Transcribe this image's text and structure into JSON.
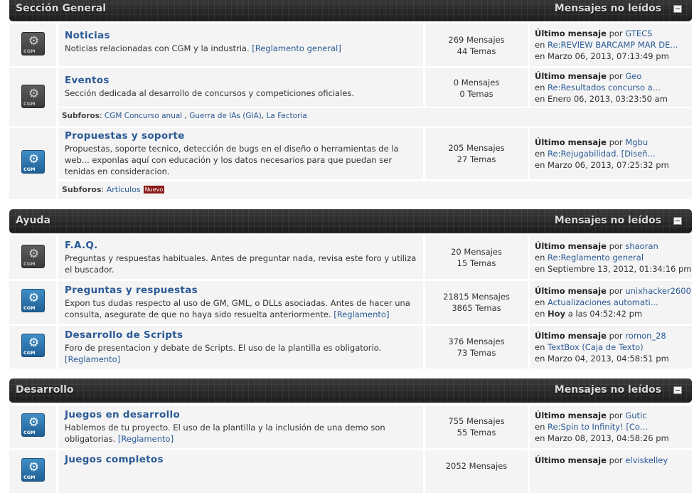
{
  "categories": [
    {
      "title": "Sección General",
      "unread": "Mensajes no leídos"
    },
    {
      "title": "Ayuda",
      "unread": "Mensajes no leídos"
    },
    {
      "title": "Desarrollo",
      "unread": "Mensajes no leídos"
    }
  ],
  "icon_text": "CGM",
  "boards": [
    {
      "name": "Noticias",
      "desc": "Noticias relacionadas con CGM y la industria.",
      "desc_link": "[Reglamento general]",
      "posts": "269 Mensajes",
      "topics": "44 Temas",
      "lp_label": "Último mensaje",
      "lp_by": "por",
      "lp_user": "GTECS",
      "lp_in": "en",
      "lp_topic": "Re:REVIEW BARCAMP MAR DE...",
      "lp_date": "en Marzo 06, 2013, 07:13:49 pm"
    },
    {
      "name": "Eventos",
      "desc": "Sección dedicada al desarrollo de concursos y competiciones oficiales.",
      "desc_link": "",
      "posts": "0 Mensajes",
      "topics": "0 Temas",
      "lp_label": "Último mensaje",
      "lp_by": "por",
      "lp_user": "Geo",
      "lp_in": "en",
      "lp_topic": "Re:Resultados concurso a...",
      "lp_date": "en Enero 06, 2013, 03:23:50 am"
    },
    {
      "name": "Propuestas y soporte",
      "desc": "Propuestas, soporte tecnico, detección de bugs en el diseño o herramientas de la web... exponlas aquí con educación y los datos necesarios para que puedan ser tenidas en consideracion.",
      "desc_link": "",
      "posts": "205 Mensajes",
      "topics": "27 Temas",
      "lp_label": "Último mensaje",
      "lp_by": "por",
      "lp_user": "Mgbu",
      "lp_in": "en",
      "lp_topic": "Re:Rejugabilidad. [Diseñ...",
      "lp_date": "en Marzo 06, 2013, 07:25:32 pm"
    },
    {
      "name": "F.A.Q.",
      "desc": "Preguntas y respuestas habituales. Antes de preguntar nada, revisa este foro y utiliza el buscador.",
      "desc_link": "",
      "posts": "20 Mensajes",
      "topics": "15 Temas",
      "lp_label": "Último mensaje",
      "lp_by": "por",
      "lp_user": "shaoran",
      "lp_in": "en",
      "lp_topic": "Re:Reglamento general",
      "lp_date": "en Septiembre 13, 2012, 01:34:16 pm"
    },
    {
      "name": "Preguntas y respuestas",
      "desc": "Expon tus dudas respecto al uso de GM, GML, o DLLs asociadas. Antes de hacer una consulta, asegurate de que no haya sido resuelta anteriormente.",
      "desc_link": "[Reglamento]",
      "posts": "21815 Mensajes",
      "topics": "3865 Temas",
      "lp_label": "Último mensaje",
      "lp_by": "por",
      "lp_user": "unixhacker2600",
      "lp_in": "en",
      "lp_topic": "Actualizaciones automati...",
      "lp_date_prefix": "en",
      "lp_date_bold": "Hoy",
      "lp_date": "a las 04:52:42 pm"
    },
    {
      "name": "Desarrollo de Scripts",
      "desc": "Foro de presentacion y debate de Scripts. El uso de la plantilla es obligatorio.",
      "desc_link": "[Reglamento]",
      "posts": "376 Mensajes",
      "topics": "73 Temas",
      "lp_label": "Último mensaje",
      "lp_by": "por",
      "lp_user": "romon_28",
      "lp_in": "en",
      "lp_topic": "TextBox (Caja de Texto)",
      "lp_date": "en Marzo 04, 2013, 04:58:51 pm"
    },
    {
      "name": "Juegos en desarrollo",
      "desc": "Hablemos de tu proyecto. El uso de la plantilla y la inclusión de una demo son obligatorias.",
      "desc_link": "[Reglamento]",
      "posts": "755 Mensajes",
      "topics": "55 Temas",
      "lp_label": "Último mensaje",
      "lp_by": "por",
      "lp_user": "Gutic",
      "lp_in": "en",
      "lp_topic": "Re:Spin to Infinity! [Co...",
      "lp_date": "en Marzo 08, 2013, 04:58:26 pm"
    },
    {
      "name": "Juegos completos",
      "desc": "",
      "desc_link": "",
      "posts": "2052 Mensajes",
      "topics": "",
      "lp_label": "Último mensaje",
      "lp_by": "por",
      "lp_user": "elviskelley",
      "lp_in": "",
      "lp_topic": "",
      "lp_date": ""
    }
  ],
  "subforos": [
    {
      "label": "Subforos",
      "items": [
        "CGM Concurso anual",
        "Guerra de IAs (GIA)",
        "La Factoria"
      ]
    },
    {
      "label": "Subforos",
      "items": [
        "Artículos"
      ],
      "badge": "Nuevo"
    }
  ]
}
